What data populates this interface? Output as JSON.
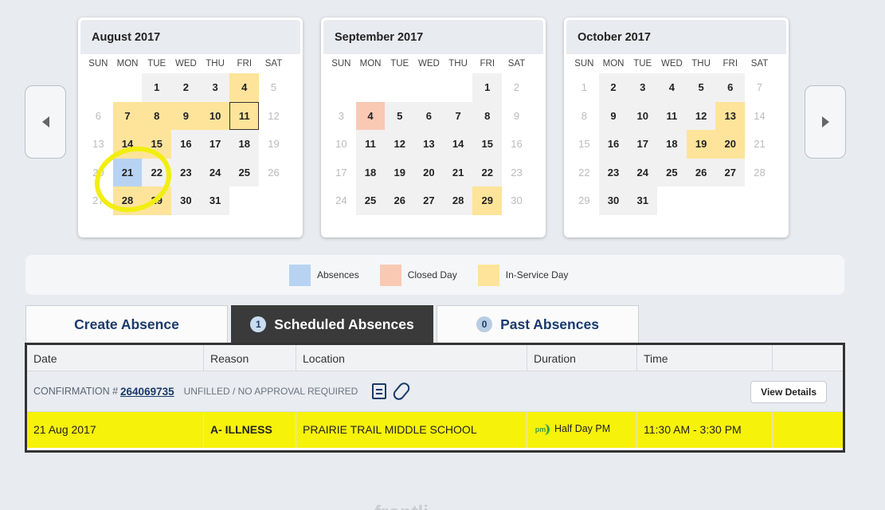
{
  "dow": [
    "SUN",
    "MON",
    "TUE",
    "WED",
    "THU",
    "FRI",
    "SAT"
  ],
  "months": [
    {
      "title": "August 2017",
      "weeks": [
        [
          {
            "d": ""
          },
          {
            "d": ""
          },
          {
            "d": "1",
            "t": "school"
          },
          {
            "d": "2",
            "t": "school"
          },
          {
            "d": "3",
            "t": "school"
          },
          {
            "d": "4",
            "t": "inservice"
          },
          {
            "d": "5",
            "t": "wk"
          }
        ],
        [
          {
            "d": "6",
            "t": "wk"
          },
          {
            "d": "7",
            "t": "inservice"
          },
          {
            "d": "8",
            "t": "inservice"
          },
          {
            "d": "9",
            "t": "inservice"
          },
          {
            "d": "10",
            "t": "inservice"
          },
          {
            "d": "11",
            "t": "inservice today"
          },
          {
            "d": "12",
            "t": "wk"
          }
        ],
        [
          {
            "d": "13",
            "t": "wk"
          },
          {
            "d": "14",
            "t": "inservice"
          },
          {
            "d": "15",
            "t": "inservice"
          },
          {
            "d": "16",
            "t": "school"
          },
          {
            "d": "17",
            "t": "school"
          },
          {
            "d": "18",
            "t": "school"
          },
          {
            "d": "19",
            "t": "wk"
          }
        ],
        [
          {
            "d": "20",
            "t": "wk"
          },
          {
            "d": "21",
            "t": "absence"
          },
          {
            "d": "22",
            "t": "school"
          },
          {
            "d": "23",
            "t": "school"
          },
          {
            "d": "24",
            "t": "school"
          },
          {
            "d": "25",
            "t": "school"
          },
          {
            "d": "26",
            "t": "wk"
          }
        ],
        [
          {
            "d": "27",
            "t": "wk"
          },
          {
            "d": "28",
            "t": "inservice"
          },
          {
            "d": "29",
            "t": "inservice"
          },
          {
            "d": "30",
            "t": "school"
          },
          {
            "d": "31",
            "t": "school"
          },
          {
            "d": ""
          },
          {
            "d": ""
          }
        ]
      ]
    },
    {
      "title": "September 2017",
      "weeks": [
        [
          {
            "d": ""
          },
          {
            "d": ""
          },
          {
            "d": ""
          },
          {
            "d": ""
          },
          {
            "d": ""
          },
          {
            "d": "1",
            "t": "school"
          },
          {
            "d": "2",
            "t": "wk"
          }
        ],
        [
          {
            "d": "3",
            "t": "wk"
          },
          {
            "d": "4",
            "t": "closed"
          },
          {
            "d": "5",
            "t": "school"
          },
          {
            "d": "6",
            "t": "school"
          },
          {
            "d": "7",
            "t": "school"
          },
          {
            "d": "8",
            "t": "school"
          },
          {
            "d": "9",
            "t": "wk"
          }
        ],
        [
          {
            "d": "10",
            "t": "wk"
          },
          {
            "d": "11",
            "t": "school"
          },
          {
            "d": "12",
            "t": "school"
          },
          {
            "d": "13",
            "t": "school"
          },
          {
            "d": "14",
            "t": "school"
          },
          {
            "d": "15",
            "t": "school"
          },
          {
            "d": "16",
            "t": "wk"
          }
        ],
        [
          {
            "d": "17",
            "t": "wk"
          },
          {
            "d": "18",
            "t": "school"
          },
          {
            "d": "19",
            "t": "school"
          },
          {
            "d": "20",
            "t": "school"
          },
          {
            "d": "21",
            "t": "school"
          },
          {
            "d": "22",
            "t": "school"
          },
          {
            "d": "23",
            "t": "wk"
          }
        ],
        [
          {
            "d": "24",
            "t": "wk"
          },
          {
            "d": "25",
            "t": "school"
          },
          {
            "d": "26",
            "t": "school"
          },
          {
            "d": "27",
            "t": "school"
          },
          {
            "d": "28",
            "t": "school"
          },
          {
            "d": "29",
            "t": "inservice"
          },
          {
            "d": "30",
            "t": "wk"
          }
        ]
      ]
    },
    {
      "title": "October 2017",
      "weeks": [
        [
          {
            "d": "1",
            "t": "wk"
          },
          {
            "d": "2",
            "t": "school"
          },
          {
            "d": "3",
            "t": "school"
          },
          {
            "d": "4",
            "t": "school"
          },
          {
            "d": "5",
            "t": "school"
          },
          {
            "d": "6",
            "t": "school"
          },
          {
            "d": "7",
            "t": "wk"
          }
        ],
        [
          {
            "d": "8",
            "t": "wk"
          },
          {
            "d": "9",
            "t": "school"
          },
          {
            "d": "10",
            "t": "school"
          },
          {
            "d": "11",
            "t": "school"
          },
          {
            "d": "12",
            "t": "school"
          },
          {
            "d": "13",
            "t": "inservice"
          },
          {
            "d": "14",
            "t": "wk"
          }
        ],
        [
          {
            "d": "15",
            "t": "wk"
          },
          {
            "d": "16",
            "t": "school"
          },
          {
            "d": "17",
            "t": "school"
          },
          {
            "d": "18",
            "t": "school"
          },
          {
            "d": "19",
            "t": "inservice"
          },
          {
            "d": "20",
            "t": "inservice"
          },
          {
            "d": "21",
            "t": "wk"
          }
        ],
        [
          {
            "d": "22",
            "t": "wk"
          },
          {
            "d": "23",
            "t": "school"
          },
          {
            "d": "24",
            "t": "school"
          },
          {
            "d": "25",
            "t": "school"
          },
          {
            "d": "26",
            "t": "school"
          },
          {
            "d": "27",
            "t": "school"
          },
          {
            "d": "28",
            "t": "wk"
          }
        ],
        [
          {
            "d": "29",
            "t": "wk"
          },
          {
            "d": "30",
            "t": "school"
          },
          {
            "d": "31",
            "t": "school"
          },
          {
            "d": ""
          },
          {
            "d": ""
          },
          {
            "d": ""
          },
          {
            "d": ""
          }
        ]
      ]
    }
  ],
  "legend": [
    {
      "label": "Absences",
      "color": "#b8d3f2"
    },
    {
      "label": "Closed Day",
      "color": "#f9c9b4"
    },
    {
      "label": "In-Service Day",
      "color": "#fde49a"
    }
  ],
  "tabs": [
    {
      "label": "Create Absence",
      "badge": ""
    },
    {
      "label": "Scheduled Absences",
      "badge": "1"
    },
    {
      "label": "Past Absences",
      "badge": "0"
    }
  ],
  "table": {
    "columns": [
      "Date",
      "Reason",
      "Location",
      "Duration",
      "Time",
      ""
    ],
    "confirmation_label": "CONFIRMATION #",
    "confirmation_number": "264069735",
    "status": "UNFILLED / NO APPROVAL REQUIRED",
    "view_details": "View Details",
    "row": {
      "date": "21 Aug 2017",
      "reason": "A- ILLNESS",
      "location": "PRAIRIE TRAIL MIDDLE SCHOOL",
      "duration_badge": "pm",
      "duration": "Half Day PM",
      "time": "11:30 AM - 3:30 PM"
    }
  },
  "footer_logo": "frontli"
}
